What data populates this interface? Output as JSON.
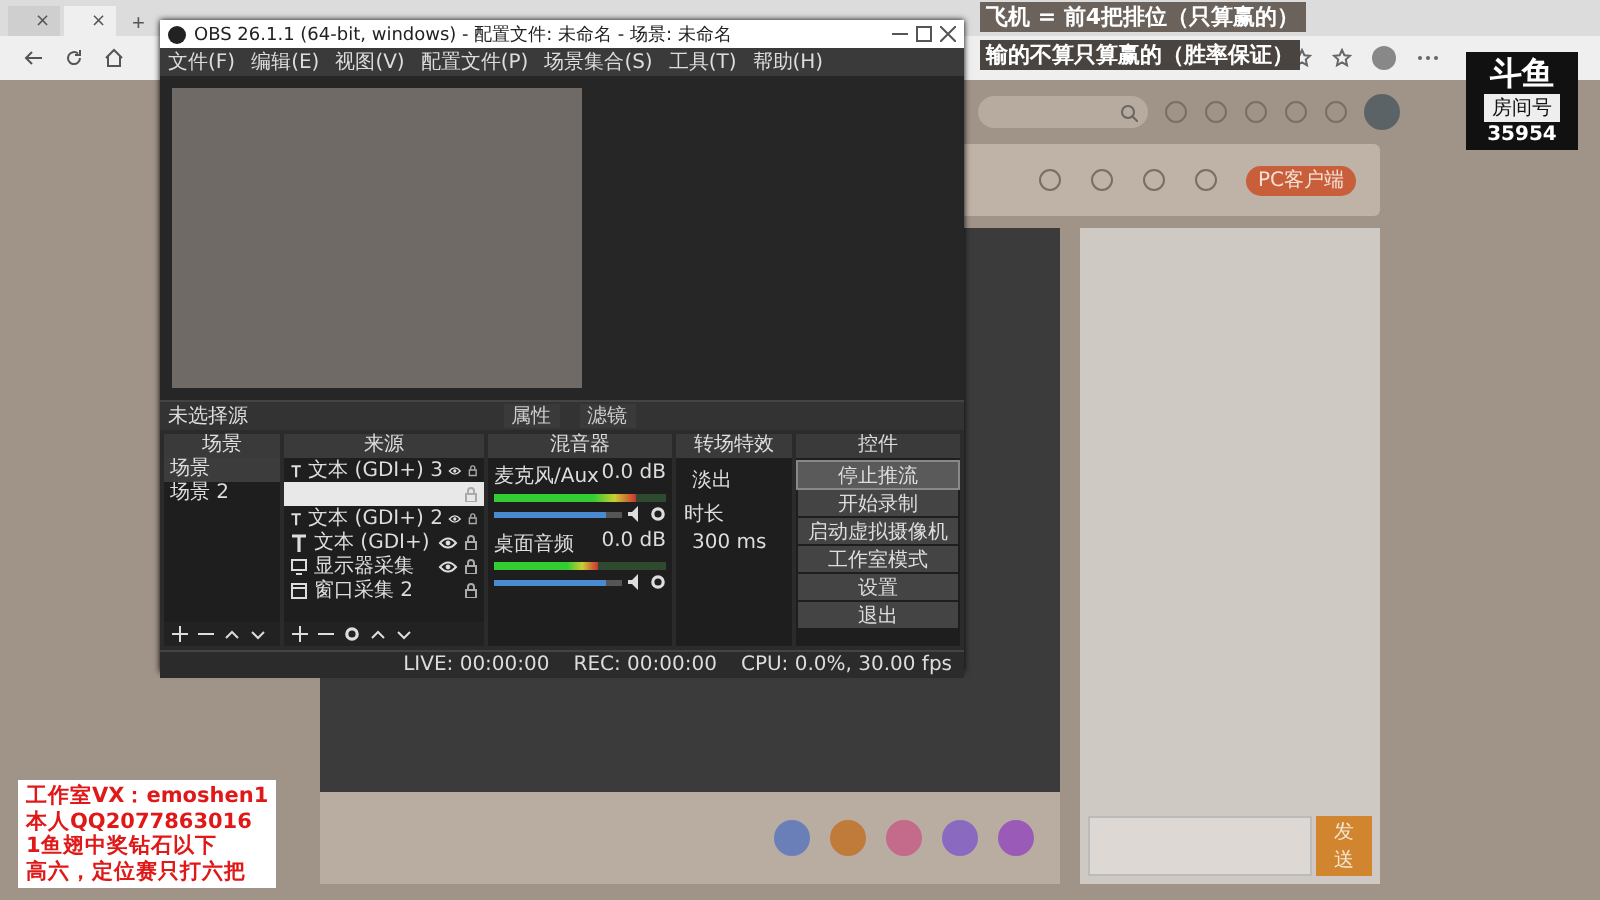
{
  "browser": {
    "tabs": [
      {
        "selected": false,
        "close": "×"
      },
      {
        "selected": true,
        "close": "×"
      }
    ],
    "new_tab": "+"
  },
  "stream_overlay": {
    "top_lines": [
      "飞机 = 前4把排位（只算赢的）",
      "输的不算只算赢的（胜率保证）"
    ],
    "contact_lines": [
      "工作室VX：emoshen1",
      "本人QQ2077863016",
      "1鱼翅中奖钻石以下",
      "高六，定位赛只打六把"
    ]
  },
  "logo": {
    "name": "斗鱼",
    "label": "房间号",
    "room": "35954"
  },
  "page": {
    "pc_client": "PC客户端",
    "send": "发送"
  },
  "obs": {
    "title": "OBS 26.1.1 (64-bit, windows) - 配置文件: 未命名 - 场景: 未命名",
    "menu": [
      "文件(F)",
      "编辑(E)",
      "视图(V)",
      "配置文件(P)",
      "场景集合(S)",
      "工具(T)",
      "帮助(H)"
    ],
    "source_status": "未选择源",
    "source_buttons": [
      "属性",
      "滤镜"
    ],
    "scenes": {
      "title": "场景",
      "items": [
        {
          "label": "场景",
          "selected": true
        },
        {
          "label": "场景 2",
          "selected": false
        }
      ]
    },
    "sources": {
      "title": "来源",
      "items": [
        {
          "kind": "text",
          "label": "文本 (GDI+) 3",
          "visible": true,
          "selected": false
        },
        {
          "kind": "blank",
          "selected": true
        },
        {
          "kind": "text",
          "label": "文本 (GDI+) 2",
          "visible": true,
          "selected": false
        },
        {
          "kind": "text",
          "label": "文本 (GDI+)",
          "visible": true,
          "selected": false
        },
        {
          "kind": "monitor",
          "label": "显示器采集",
          "visible": true,
          "selected": false
        },
        {
          "kind": "window",
          "label": "窗口采集 2",
          "visible": false,
          "selected": false
        }
      ]
    },
    "mixer": {
      "title": "混音器",
      "channels": [
        {
          "name": "麦克风/Aux",
          "reading": "0.0 dB",
          "meter": {
            "level": 0.82
          },
          "volume": {
            "level": 0.88
          }
        },
        {
          "name": "桌面音频",
          "reading": "0.0 dB",
          "meter": {
            "level": 0.6
          },
          "volume": {
            "level": 0.88
          }
        }
      ]
    },
    "transitions": {
      "title": "转场特效",
      "selected": "淡出",
      "duration_label": "时长",
      "duration": "300 ms"
    },
    "controls": {
      "title": "控件",
      "buttons": [
        {
          "label": "停止推流",
          "selected": true
        },
        {
          "label": "开始录制",
          "selected": false
        },
        {
          "label": "启动虚拟摄像机",
          "selected": false
        },
        {
          "label": "工作室模式",
          "selected": false
        },
        {
          "label": "设置",
          "selected": false
        },
        {
          "label": "退出",
          "selected": false
        }
      ]
    },
    "status": {
      "live": "LIVE: 00:00:00",
      "rec": "REC: 00:00:00",
      "cpu": "CPU: 0.0%, 30.00 fps"
    }
  }
}
